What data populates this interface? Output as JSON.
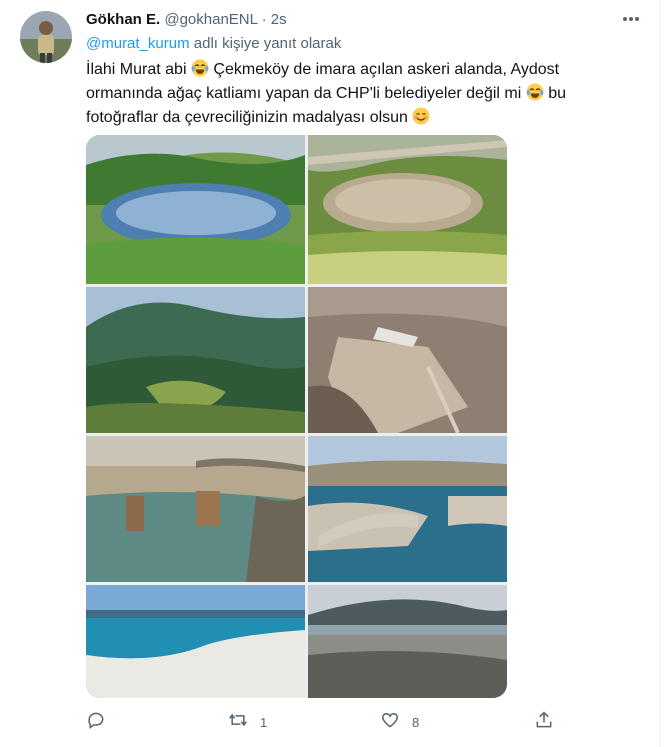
{
  "tweet": {
    "display_name": "Gökhan E.",
    "handle": "@gokhanENL",
    "separator": "·",
    "time": "2s",
    "reply_to": "@murat_kurum",
    "reply_suffix": "adlı kişiye yanıt olarak",
    "text_part1": "İlahi Murat abi",
    "text_part2": "Çekmeköy de imara açılan askeri alanda, Aydost ormanında ağaç katliamı yapan da CHP'li belediyeler değil mi",
    "text_part3": "bu fotoğraflar da çevreciliğinizin madalyası olsun",
    "emoji_1": "face-with-tears-of-joy",
    "emoji_2": "face-with-tears-of-joy",
    "emoji_3": "smiling-face-with-smiling-eyes"
  },
  "media": {
    "image_count": 8,
    "tiles": [
      "crater-lake-green-hills",
      "muddy-lake-meadow-flowers",
      "forested-mountain-aerial",
      "mining-excavation-site",
      "river-rock-pillars-bridge",
      "stone-arch-bridge-reservoir",
      "white-shore-turquoise-lake",
      "mountain-lake-crowd"
    ]
  },
  "actions": {
    "reply_count": "",
    "retweet_count": "1",
    "like_count": "8",
    "share_count": ""
  },
  "colors": {
    "accent": "#1d9bf0",
    "muted": "#536471",
    "text": "#0f1419"
  }
}
